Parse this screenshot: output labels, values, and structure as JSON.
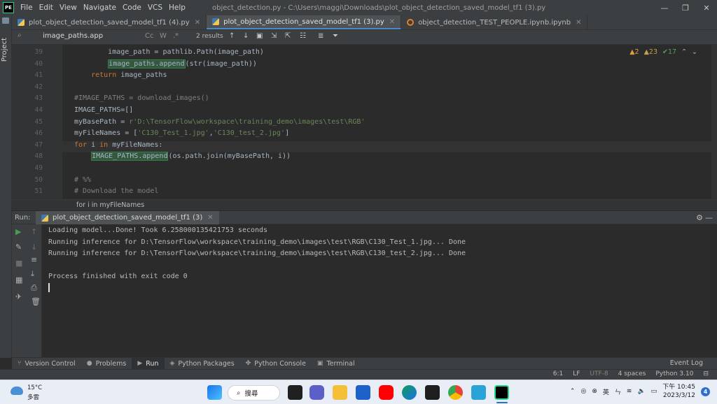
{
  "titlebar": {
    "logo": "PE",
    "menu": [
      "File",
      "Edit",
      "View",
      "Navigate",
      "Code",
      "VCS",
      "Help"
    ],
    "title": "object_detection.py - C:\\Users\\maggi\\Downloads\\plot_object_detection_saved_model_tf1 (3).py",
    "min": "—",
    "max": "❐",
    "close": "✕"
  },
  "sidebar": {
    "project_label": "Project"
  },
  "tabs": [
    {
      "label": "plot_object_detection_saved_model_tf1 (4).py",
      "active": false,
      "icon": "python-file-icon"
    },
    {
      "label": "plot_object_detection_saved_model_tf1 (3).py",
      "active": true,
      "icon": "python-file-icon"
    },
    {
      "label": "object_detection_TEST_PEOPLE.ipynb.ipynb",
      "active": false,
      "icon": "notebook-icon"
    }
  ],
  "search": {
    "query": "image_paths.app",
    "results": "2 results",
    "case_label": "Cc",
    "word_label": "W",
    "regex_label": ".*"
  },
  "inspection": {
    "warnings": "▲2",
    "weak_warnings": "▲23",
    "typos": "✔17"
  },
  "editor": {
    "lines": [
      {
        "num": "39",
        "html": "        <span>image_path = pathlib.Path(image_path)</span>"
      },
      {
        "num": "40",
        "html": "        <span class=\"hl\">image_paths.append</span>(str(image_path))"
      },
      {
        "num": "41",
        "html": "    <span class=\"kw\">return</span> image_paths"
      },
      {
        "num": "42",
        "html": ""
      },
      {
        "num": "43",
        "html": "<span class=\"cmt\">#IMAGE_PATHS = download_images()</span>"
      },
      {
        "num": "44",
        "html": "IMAGE_PATHS=[]"
      },
      {
        "num": "45",
        "html": "myBasePath = <span class=\"str\">r'D:\\TensorFlow\\workspace\\training_demo\\images\\test\\RGB'</span>"
      },
      {
        "num": "46",
        "html": "myFileNames = [<span class=\"str\">'C130_Test_1.jpg'</span>,<span class=\"str\">'C130_test_2.jpg'</span>]"
      },
      {
        "num": "47",
        "html": "<span class=\"kw\">for</span> i <span class=\"kw\">in</span> myFileNames:"
      },
      {
        "num": "48",
        "html": "    <span class=\"hl\">IMAGE_PATHS.append</span>(os.path.join(myBasePath, i))"
      },
      {
        "num": "49",
        "html": ""
      },
      {
        "num": "50",
        "html": "<span class=\"cmt\"># %%</span>"
      },
      {
        "num": "51",
        "html": "<span class=\"cmt\"># Download the model</span>"
      }
    ],
    "breadcrumb": "for i in myFileNames"
  },
  "run": {
    "label": "Run:",
    "tab_title": "plot_object_detection_saved_model_tf1 (3)",
    "console": [
      "Loading model...Done! Took 6.258000135421753 seconds",
      "Running inference for D:\\TensorFlow\\workspace\\training_demo\\images\\test\\RGB\\C130_Test_1.jpg... Done",
      "Running inference for D:\\TensorFlow\\workspace\\training_demo\\images\\test\\RGB\\C130_test_2.jpg... Done",
      "",
      "Process finished with exit code 0"
    ]
  },
  "toolwindows": [
    {
      "label": "Version Control",
      "icon": "version-control-icon",
      "glyph": "⑂",
      "active": false
    },
    {
      "label": "Problems",
      "icon": "problems-icon",
      "glyph": "●",
      "active": false
    },
    {
      "label": "Run",
      "icon": "run-icon",
      "glyph": "▶",
      "active": true
    },
    {
      "label": "Python Packages",
      "icon": "packages-icon",
      "glyph": "◈",
      "active": false
    },
    {
      "label": "Python Console",
      "icon": "console-icon",
      "glyph": "✤",
      "active": false
    },
    {
      "label": "Terminal",
      "icon": "terminal-icon",
      "glyph": "▣",
      "active": false
    }
  ],
  "event_log": "Event Log",
  "status": {
    "position": "6:1",
    "line_sep": "LF",
    "encoding": "UTF-8",
    "indent": "4 spaces",
    "interpreter": "Python 3.10"
  },
  "taskbar": {
    "temp": "15°C",
    "weather": "多雲",
    "search": "搜尋",
    "ime": "英",
    "time": "下午 10:45",
    "date": "2023/3/12",
    "notifications": "4"
  },
  "colors": {
    "accent": "#4a88c7",
    "run_green": "#499c54",
    "search_highlight": "#32593d"
  }
}
